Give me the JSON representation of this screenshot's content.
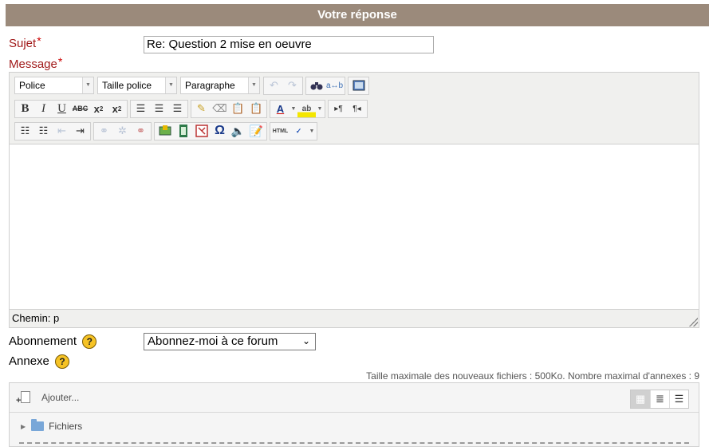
{
  "header": {
    "title": "Votre réponse"
  },
  "subject": {
    "label": "Sujet",
    "required_mark": "*",
    "value": "Re: Question 2 mise en oeuvre"
  },
  "message": {
    "label": "Message",
    "required_mark": "*"
  },
  "editor": {
    "font_dropdown": "Police",
    "size_dropdown": "Taille police",
    "format_dropdown": "Paragraphe",
    "row1_icons": [
      "undo-icon",
      "redo-icon",
      "find-icon",
      "replace-icon",
      "fullscreen-icon"
    ],
    "row2_icons": [
      "bold-icon",
      "italic-icon",
      "underline-icon",
      "strikethrough-icon",
      "subscript-icon",
      "superscript-icon",
      "align-left-icon",
      "align-center-icon",
      "align-right-icon",
      "cleanup-icon",
      "eraser-icon",
      "paste-text-icon",
      "paste-word-icon",
      "text-color-icon",
      "highlight-icon",
      "ltr-icon",
      "rtl-icon"
    ],
    "row3_icons": [
      "bullet-list-icon",
      "numbered-list-icon",
      "outdent-icon",
      "indent-icon",
      "link-icon",
      "unlink-icon",
      "anchor-icon",
      "image-icon",
      "media-icon",
      "nolink-icon",
      "special-char-icon",
      "emoticon-icon",
      "edit-icon",
      "html-icon",
      "spellcheck-icon"
    ],
    "path_text": "Chemin: p"
  },
  "subscription": {
    "label": "Abonnement",
    "selected": "Abonnez-moi à ce forum"
  },
  "attachment": {
    "label": "Annexe",
    "max_note": "Taille maximale des nouveaux fichiers : 500Ko. Nombre maximal d'annexes : 9",
    "add_label": "Ajouter...",
    "folder_label": "Fichiers"
  },
  "colors": {
    "header_bg": "#9b8a7b",
    "label_red": "#a11a1a",
    "help_yellow": "#f6c325"
  }
}
